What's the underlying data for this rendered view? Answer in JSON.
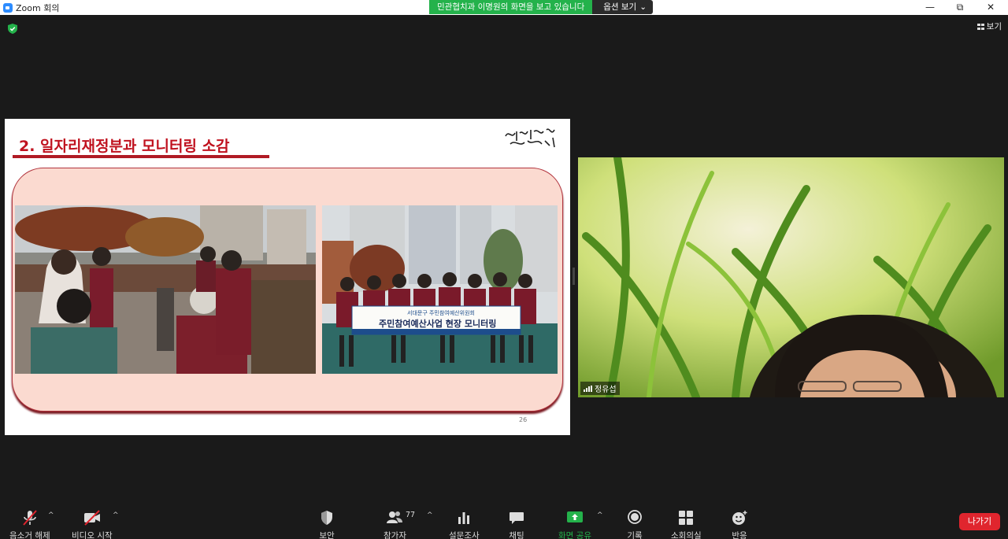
{
  "window": {
    "title": "Zoom 회의",
    "controls": [
      "—",
      "⧉",
      "✕"
    ]
  },
  "share_banner": {
    "message": "민관협치과 이명원의 화면을 보고 있습니다",
    "options_label": "옵션 보기",
    "options_caret": "⌄"
  },
  "view_button": {
    "label": "보기"
  },
  "slide": {
    "title": "2. 일자리재정분과 모니터링 소감",
    "banner_small": "서대문구 주민참여예산위원회",
    "banner_main": "주민참여예산사업 현장 모니터링",
    "page_number": "26"
  },
  "video": {
    "participant_name": "정유섭"
  },
  "toolbar": {
    "mute_label": "음소거 해제",
    "video_label": "비디오 시작",
    "security_label": "보안",
    "participants_label": "참가자",
    "participants_count": "77",
    "poll_label": "설문조사",
    "chat_label": "채팅",
    "share_label": "화면 공유",
    "record_label": "기록",
    "breakout_label": "소회의실",
    "reactions_label": "반응",
    "leave_label": "나가기",
    "caret": "^"
  },
  "colors": {
    "share_green": "#24b24b",
    "leave_red": "#e0252e",
    "slide_title_red": "#c0121f"
  }
}
